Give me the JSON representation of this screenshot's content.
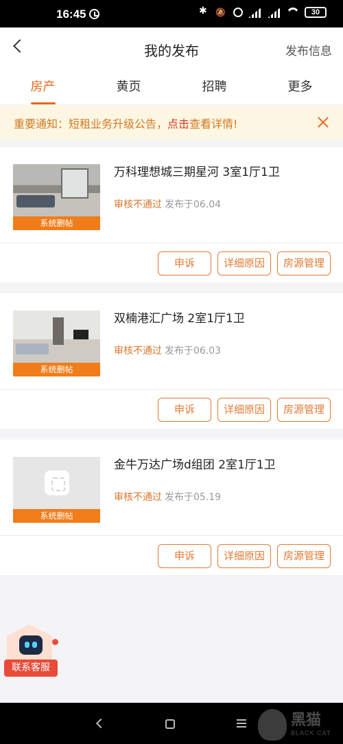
{
  "status_bar": {
    "time": "16:45",
    "battery": "30",
    "icons": [
      "alarm-icon",
      "bluetooth-icon",
      "mute-icon",
      "clock-icon",
      "signal-icon",
      "signal-icon",
      "wifi-icon",
      "battery-icon"
    ]
  },
  "header": {
    "title": "我的发布",
    "action": "发布信息"
  },
  "tabs": [
    {
      "label": "房产",
      "active": true
    },
    {
      "label": "黄页",
      "active": false
    },
    {
      "label": "招聘",
      "active": false
    },
    {
      "label": "更多",
      "active": false
    }
  ],
  "notice": {
    "prefix": "重要通知：短租业务升级公告，",
    "highlight": "点击",
    "suffix": "查看详情!"
  },
  "listings": [
    {
      "title": "万科理想城三期星河 3室1厅1卫",
      "badge": "系统删帖",
      "status": "审核不通过",
      "date": "发布于06.04",
      "buttons": [
        "申诉",
        "详细原因",
        "房源管理"
      ]
    },
    {
      "title": "双楠港汇广场 2室1厅1卫",
      "badge": "系统删帖",
      "status": "审核不通过",
      "date": "发布于06.03",
      "buttons": [
        "申诉",
        "详细原因",
        "房源管理"
      ]
    },
    {
      "title": "金牛万达广场d组团 2室1厅1卫",
      "badge": "系统删帖",
      "status": "审核不通过",
      "date": "发布于05.19",
      "buttons": [
        "申诉",
        "详细原因",
        "房源管理"
      ]
    }
  ],
  "customer_service": {
    "label": "联系客服"
  },
  "watermark": {
    "text": "黑猫",
    "sub": "BLACK CAT"
  },
  "colors": {
    "accent": "#e8681c",
    "badge": "#f07d1a",
    "notice_bg": "#fdf6e3",
    "service_red": "#e94b39"
  }
}
